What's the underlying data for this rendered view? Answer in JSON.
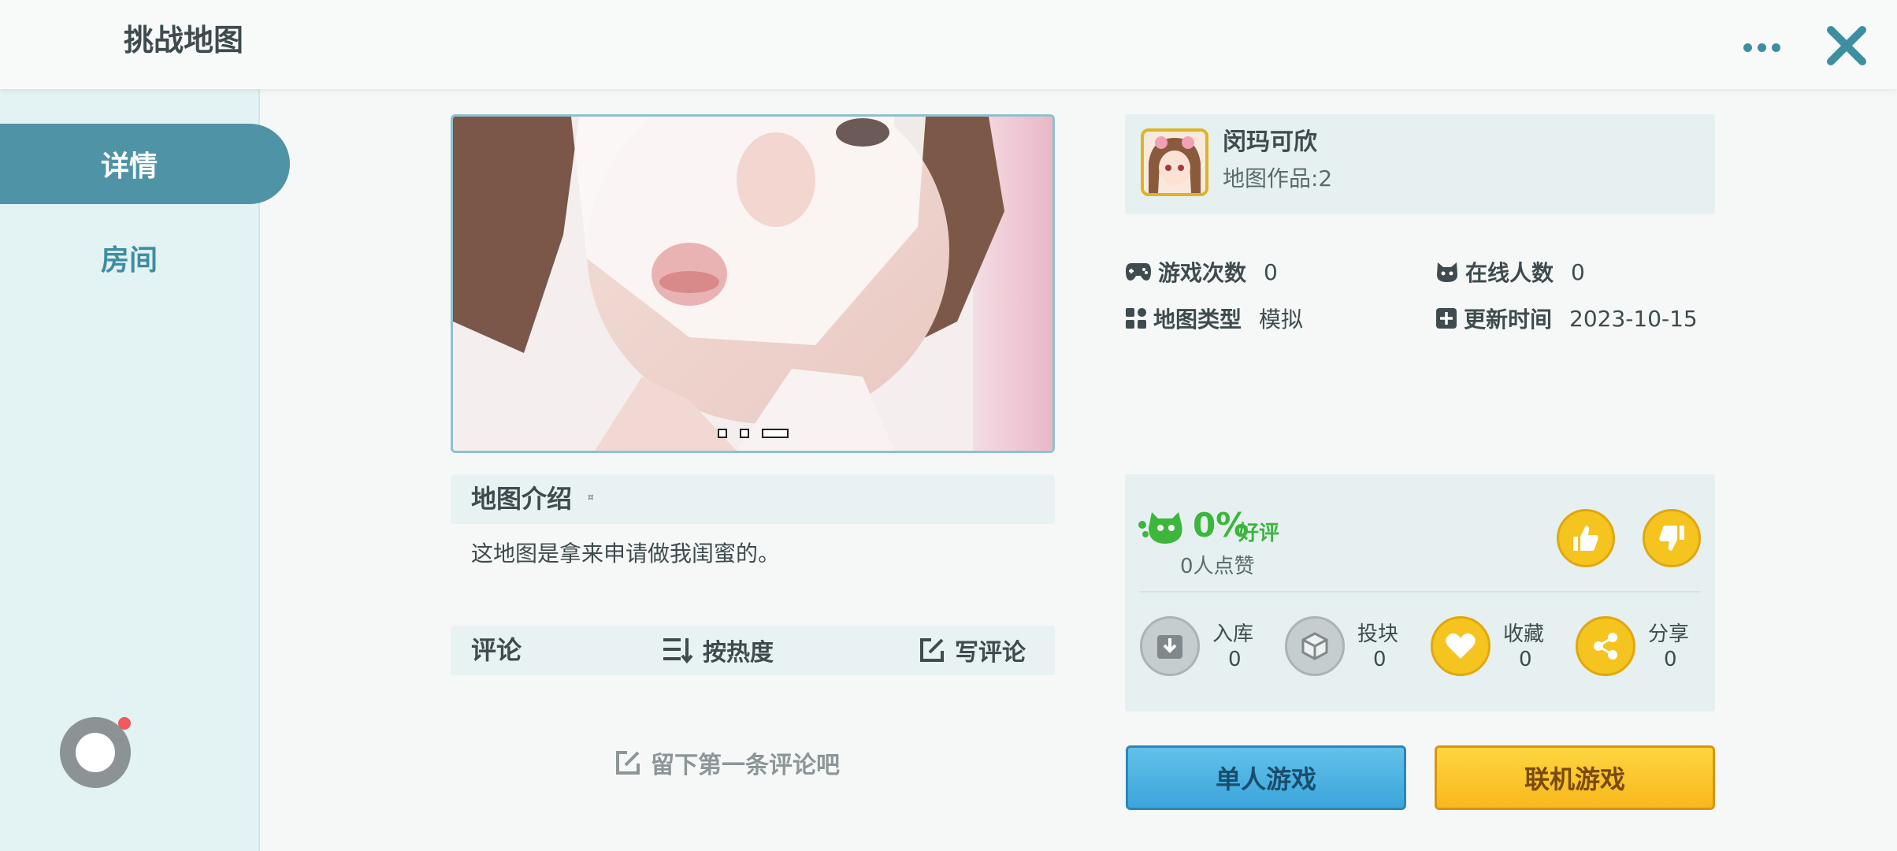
{
  "header": {
    "status_text": "​",
    "title": "挑战地图"
  },
  "sidebar": {
    "tabs": [
      {
        "label": "详情",
        "active": true
      },
      {
        "label": "房间",
        "active": false
      }
    ]
  },
  "carousel": {
    "slide_count": 3,
    "active_slide": 3
  },
  "intro": {
    "title": "地图介绍",
    "mark": "¤",
    "text": "这地图是拿来申请做我闺蜜的。"
  },
  "comments": {
    "title": "评论",
    "sort_label": "按热度",
    "write_label": "写评论",
    "empty_prompt": "留下第一条评论吧"
  },
  "author": {
    "name": "闵玛可欣",
    "works": "地图作品:2"
  },
  "stats": {
    "plays": {
      "label": "游戏次数",
      "value": "0"
    },
    "online": {
      "label": "在线人数",
      "value": "0"
    },
    "type": {
      "label": "地图类型",
      "value": "模拟"
    },
    "updated": {
      "label": "更新时间",
      "value": "2023-10-15"
    }
  },
  "rating": {
    "percent": "0%",
    "word": "好评",
    "likes": "0人点赞"
  },
  "actions": [
    {
      "label": "入库",
      "count": "0"
    },
    {
      "label": "投块",
      "count": "0"
    },
    {
      "label": "收藏",
      "count": "0"
    },
    {
      "label": "分享",
      "count": "0"
    }
  ],
  "buttons": {
    "single": "单人游戏",
    "multi": "联机游戏"
  },
  "colors": {
    "accent": "#4f93a6",
    "gold": "#f5c41e",
    "green": "#3cb63c",
    "blue_button": "#3ba5dc"
  }
}
